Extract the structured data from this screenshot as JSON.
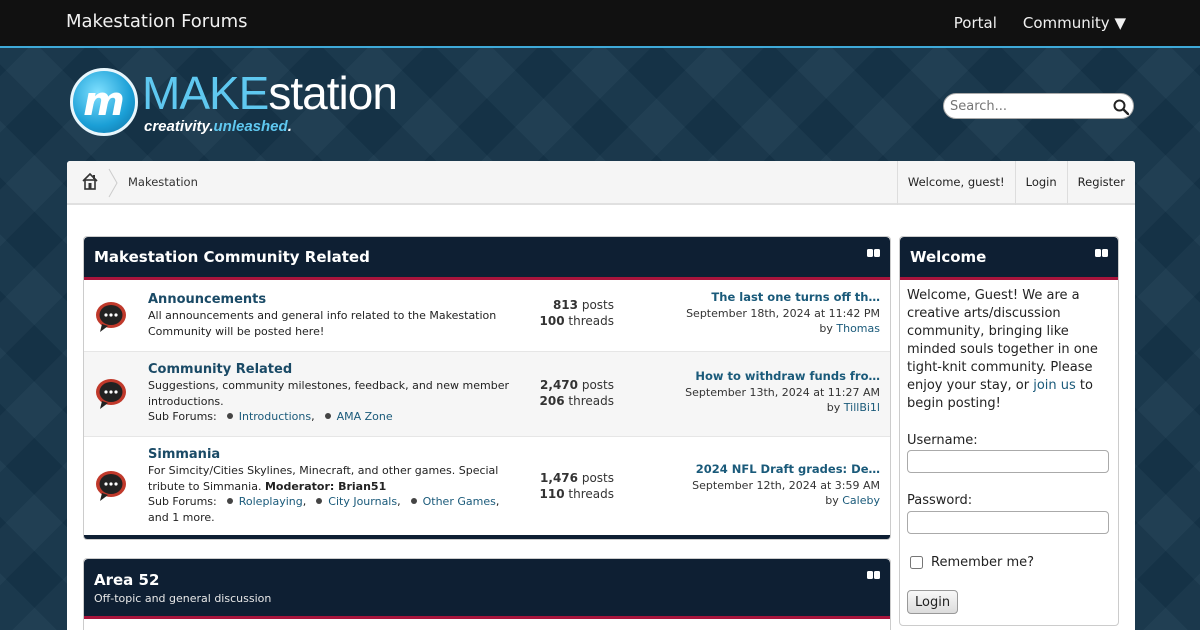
{
  "topbar": {
    "brand": "Makestation Forums",
    "nav": [
      {
        "label": "Portal"
      },
      {
        "label": "Community ▼"
      }
    ]
  },
  "logo": {
    "letter": "m",
    "word_make": "MAKE",
    "word_station": "station",
    "tagline_a": "creativity.",
    "tagline_b": "unleashed",
    "tagline_c": "."
  },
  "search": {
    "placeholder": "Search..."
  },
  "breadcrumb": {
    "current": "Makestation",
    "welcome": "Welcome, guest!",
    "login": "Login",
    "register": "Register"
  },
  "categories": [
    {
      "title": "Makestation Community Related",
      "forums": [
        {
          "name": "Announcements",
          "description": "All announcements and general info related to the Makestation Community will be posted here!",
          "posts": "813",
          "posts_label": "posts",
          "threads": "100",
          "threads_label": "threads",
          "last_title": "The last one turns off th…",
          "last_date": "September 18th, 2024 at 11:42 PM",
          "last_by": "by",
          "last_user": "Thomas"
        },
        {
          "name": "Community Related",
          "description": "Suggestions, community milestones, feedback, and new member introductions.",
          "sub_label": "Sub Forums:",
          "subforums": [
            "Introductions",
            "AMA Zone"
          ],
          "posts": "2,470",
          "posts_label": "posts",
          "threads": "206",
          "threads_label": "threads",
          "last_title": "How to withdraw funds fro…",
          "last_date": "September 13th, 2024 at 11:27 AM",
          "last_by": "by",
          "last_user": "TillBi1l"
        },
        {
          "name": "Simmania",
          "description": "For Simcity/Cities Skylines, Minecraft, and other games. Special tribute to Simmania.",
          "moderator": "Moderator: Brian51",
          "sub_label": "Sub Forums:",
          "subforums": [
            "Roleplaying",
            "City Journals",
            "Other Games"
          ],
          "more": "and 1 more.",
          "posts": "1,476",
          "posts_label": "posts",
          "threads": "110",
          "threads_label": "threads",
          "last_title": "2024 NFL Draft grades: De…",
          "last_date": "September 12th, 2024 at 3:59 AM",
          "last_by": "by",
          "last_user": "Caleby"
        }
      ]
    },
    {
      "title": "Area 52",
      "subtitle": "Off-topic and general discussion"
    }
  ],
  "sidebar": {
    "title": "Welcome",
    "text_before": "Welcome, Guest! We are a creative arts/discussion community, bringing like minded souls together in one tight-knit community. Please enjoy your stay, or ",
    "join_link": "join us",
    "text_after": " to begin posting!",
    "username_label": "Username:",
    "password_label": "Password:",
    "remember_label": "Remember me?",
    "login_button": "Login"
  },
  "colors": {
    "header_bg": "#0e1f33",
    "header_accent": "#a8143c",
    "link": "#1a5a7a",
    "topbar_accent": "#3ea9d8"
  }
}
